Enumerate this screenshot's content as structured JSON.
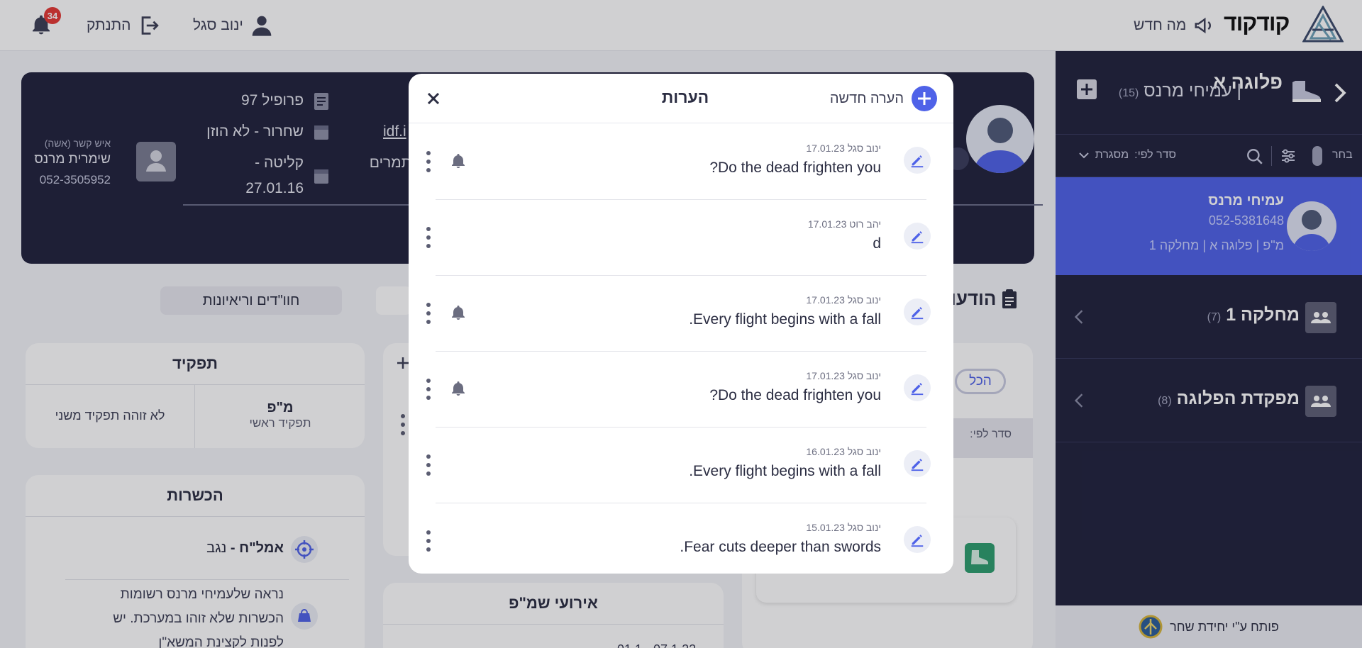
{
  "topbar": {
    "notifications_count": "34",
    "logout_label": "התנתק",
    "user_name": "ינוב סגל",
    "whats_new_label": "מה חדש",
    "brand_name": "קודקוד"
  },
  "sidebar": {
    "unit_title": "פלוגה א",
    "unit_separator": "|",
    "unit_commander": "עמיחי מרנס",
    "unit_count": "(15)",
    "choose_label": "בחר",
    "sort_label": "סדר לפי:",
    "sort_value": "מסגרת",
    "selected": {
      "name": "עמיחי מרנס",
      "phone": "052-5381648",
      "path": "מ\"פ | פלוגה א | מחלקה 1"
    },
    "groups": [
      {
        "name": "מחלקה 1",
        "count": "(7)"
      },
      {
        "name": "מפקדת הפלוגה",
        "count": "(8)"
      }
    ],
    "footer_label": "פותח ע\"י יחידת שחר"
  },
  "profile": {
    "profile_label": "פרופיל 97",
    "release_label": "שחרור - לא הוזן",
    "intake_label": "קליטה -",
    "intake_date": "27.01.16",
    "email_partial": "idf.i",
    "support_partial": "ות תמרים",
    "support_partial2": "ם",
    "contact_relation": "איש קשר (אשה)",
    "contact_name": "שימרית מרנס",
    "contact_phone": "052-3505952"
  },
  "tabs": {
    "interviews": "חוו\"דים וריאיונות",
    "updates_partial": "הודעו"
  },
  "role_card": {
    "title": "תפקיד",
    "primary_role": "מ\"פ",
    "primary_label": "תפקיד ראשי",
    "secondary": "לא זוהה תפקיד משני"
  },
  "qualifications_card": {
    "title": "הכשרות",
    "item_bold": "אמל\"ח -",
    "item_value": "נגב",
    "warning_text": "נראה שלעמיחי מרנס רשומות הכשרות שלא זוהו במערכת. יש לפנות לקצינת המשא\"ן"
  },
  "events_card": {
    "title": "אירועי שמ\"פ",
    "date_partial": "01.1 - 07.1.22"
  },
  "right_panel": {
    "filter_all": "הכל",
    "sort_partial": "סדר לפי:"
  },
  "modal": {
    "title": "הערות",
    "new_note_label": "הערה חדשה",
    "notes": [
      {
        "author": "ינוב סגל",
        "date": "17.01.23",
        "text": "Do the dead frighten you?",
        "bell": true
      },
      {
        "author": "יהב רוט",
        "date": "17.01.23",
        "text": "d",
        "bell": false
      },
      {
        "author": "ינוב סגל",
        "date": "17.01.23",
        "text": "Every flight begins with a fall.",
        "bell": true
      },
      {
        "author": "ינוב סגל",
        "date": "17.01.23",
        "text": "Do the dead frighten you?",
        "bell": true
      },
      {
        "author": "ינוב סגל",
        "date": "16.01.23",
        "text": "Every flight begins with a fall.",
        "bell": false
      },
      {
        "author": "ינוב סגל",
        "date": "15.01.23",
        "text": "Fear cuts deeper than swords.",
        "bell": false
      }
    ]
  },
  "colors": {
    "accent": "#4f62e8",
    "navy": "#21223d",
    "danger": "#e53935"
  }
}
